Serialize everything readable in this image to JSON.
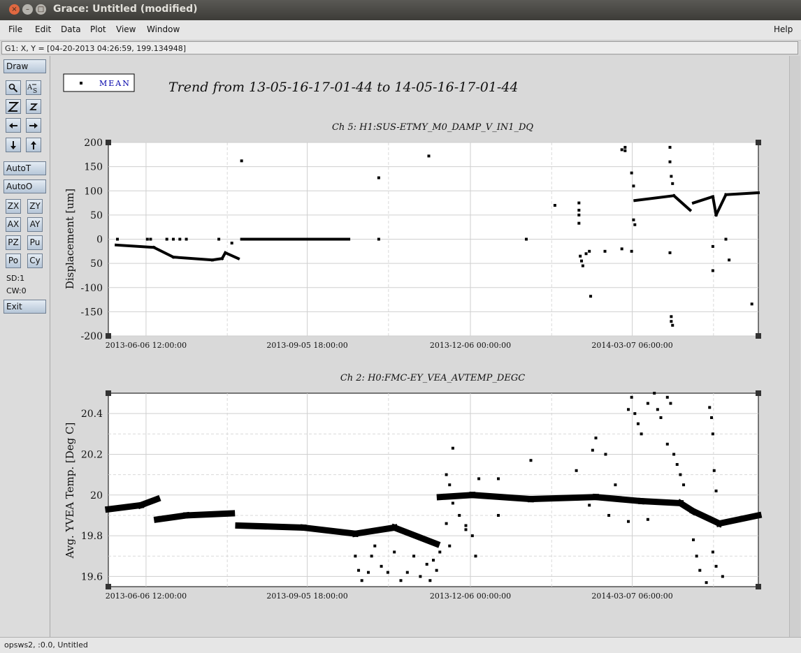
{
  "window": {
    "title": "Grace: Untitled (modified)"
  },
  "menu": {
    "file": "File",
    "edit": "Edit",
    "data": "Data",
    "plot": "Plot",
    "view": "View",
    "window": "Window",
    "help": "Help"
  },
  "locator": "G1: X, Y = [04-20-2013 04:26:59, 199.134948]",
  "toolbar": {
    "draw": "Draw",
    "autot": "AutoT",
    "autoo": "AutoO",
    "zx": "ZX",
    "zy": "ZY",
    "ax": "AX",
    "ay": "AY",
    "pz": "PZ",
    "pu": "Pu",
    "po": "Po",
    "cy": "Cy",
    "sd": "SD:1",
    "cw": "CW:0",
    "exit": "Exit",
    "icons": [
      "zoom-icon",
      "text-icon",
      "zoom-in-icon",
      "zoom-out-icon",
      "arrow-left-icon",
      "arrow-right-icon",
      "arrow-down-icon",
      "arrow-up-icon"
    ]
  },
  "statusbar": "opsws2, :0.0, Untitled",
  "legend": {
    "label": "MEAN"
  },
  "main_title": "Trend from 13-05-16-17-01-44 to 14-05-16-17-01-44",
  "chart_data": [
    {
      "type": "scatter",
      "title": "Ch 5: H1:SUS-ETMY_M0_DAMP_V_IN1_DQ",
      "ylabel": "Displacement [um]",
      "xlabel": "",
      "x_tick_labels": [
        "2013-06-06 12:00:00",
        "2013-09-05 18:00:00",
        "2013-12-06 00:00:00",
        "2014-03-07 06:00:00"
      ],
      "y_tick_labels": [
        "200",
        "150",
        "100",
        "50",
        "0",
        "50",
        "-100",
        "-150",
        "-200"
      ],
      "ylim": [
        -200,
        200
      ],
      "xlim": [
        0,
        1
      ],
      "grid": true,
      "series": [
        {
          "segments": [
            {
              "x0": 0.012,
              "y0": -12,
              "x1": 0.07,
              "y1": -17
            },
            {
              "x0": 0.07,
              "y0": -17,
              "x1": 0.1,
              "y1": -37
            },
            {
              "x0": 0.1,
              "y0": -37,
              "x1": 0.16,
              "y1": -43
            },
            {
              "x0": 0.16,
              "y0": -43,
              "x1": 0.175,
              "y1": -40
            },
            {
              "x0": 0.175,
              "y0": -40,
              "x1": 0.18,
              "y1": -28
            },
            {
              "x0": 0.18,
              "y0": -28,
              "x1": 0.2,
              "y1": -40
            },
            {
              "x0": 0.205,
              "y0": 0,
              "x1": 0.37,
              "y1": 0
            },
            {
              "x0": 0.81,
              "y0": 80,
              "x1": 0.87,
              "y1": 90
            },
            {
              "x0": 0.87,
              "y0": 90,
              "x1": 0.895,
              "y1": 60
            },
            {
              "x0": 0.9,
              "y0": 75,
              "x1": 0.93,
              "y1": 88
            },
            {
              "x0": 0.93,
              "y0": 88,
              "x1": 0.935,
              "y1": 50
            },
            {
              "x0": 0.935,
              "y0": 50,
              "x1": 0.95,
              "y1": 92
            },
            {
              "x0": 0.95,
              "y0": 92,
              "x1": 1.0,
              "y1": 96
            }
          ],
          "points": [
            [
              0.014,
              0
            ],
            [
              0.06,
              0
            ],
            [
              0.065,
              0
            ],
            [
              0.09,
              0
            ],
            [
              0.1,
              0
            ],
            [
              0.11,
              0
            ],
            [
              0.12,
              0
            ],
            [
              0.17,
              0
            ],
            [
              0.19,
              -8
            ],
            [
              0.205,
              162
            ],
            [
              0.416,
              127
            ],
            [
              0.416,
              0
            ],
            [
              0.493,
              172
            ],
            [
              0.643,
              0
            ],
            [
              0.687,
              70
            ],
            [
              0.724,
              75
            ],
            [
              0.724,
              60
            ],
            [
              0.724,
              50
            ],
            [
              0.724,
              33
            ],
            [
              0.726,
              -35
            ],
            [
              0.728,
              -45
            ],
            [
              0.73,
              -55
            ],
            [
              0.735,
              -30
            ],
            [
              0.74,
              -25
            ],
            [
              0.742,
              -118
            ],
            [
              0.764,
              -25
            ],
            [
              0.79,
              -20
            ],
            [
              0.79,
              185
            ],
            [
              0.795,
              190
            ],
            [
              0.795,
              183
            ],
            [
              0.805,
              137
            ],
            [
              0.805,
              -25
            ],
            [
              0.808,
              110
            ],
            [
              0.808,
              40
            ],
            [
              0.81,
              30
            ],
            [
              0.864,
              190
            ],
            [
              0.864,
              160
            ],
            [
              0.866,
              130
            ],
            [
              0.868,
              115
            ],
            [
              0.864,
              -28
            ],
            [
              0.866,
              -160
            ],
            [
              0.866,
              -170
            ],
            [
              0.868,
              -178
            ],
            [
              0.93,
              -15
            ],
            [
              0.93,
              -65
            ],
            [
              0.95,
              0
            ],
            [
              0.955,
              -43
            ],
            [
              0.99,
              -134
            ]
          ]
        }
      ]
    },
    {
      "type": "scatter",
      "title": "Ch 2: H0:FMC-EY_VEA_AVTEMP_DEGC",
      "ylabel": "Avg. YVEA Temp. [Deg C]",
      "xlabel": "",
      "x_tick_labels": [
        "2013-06-06 12:00:00",
        "2013-09-05 18:00:00",
        "2013-12-06 00:00:00",
        "2014-03-07 06:00:00"
      ],
      "y_tick_labels": [
        "20.4",
        "20.2",
        "20",
        "19.8",
        "19.6"
      ],
      "ylim": [
        19.55,
        20.5
      ],
      "xlim": [
        0,
        1
      ],
      "grid": true,
      "series": [
        {
          "segments": [
            {
              "x0": 0.0,
              "y0": 19.93,
              "x1": 0.05,
              "y1": 19.95
            },
            {
              "x0": 0.05,
              "y0": 19.95,
              "x1": 0.075,
              "y1": 19.98
            },
            {
              "x0": 0.075,
              "y0": 19.88,
              "x1": 0.12,
              "y1": 19.9
            },
            {
              "x0": 0.12,
              "y0": 19.9,
              "x1": 0.19,
              "y1": 19.91
            },
            {
              "x0": 0.2,
              "y0": 19.85,
              "x1": 0.3,
              "y1": 19.84
            },
            {
              "x0": 0.3,
              "y0": 19.84,
              "x1": 0.38,
              "y1": 19.81
            },
            {
              "x0": 0.38,
              "y0": 19.81,
              "x1": 0.44,
              "y1": 19.84
            },
            {
              "x0": 0.44,
              "y0": 19.84,
              "x1": 0.505,
              "y1": 19.76
            },
            {
              "x0": 0.51,
              "y0": 19.99,
              "x1": 0.56,
              "y1": 20.0
            },
            {
              "x0": 0.56,
              "y0": 20.0,
              "x1": 0.65,
              "y1": 19.98
            },
            {
              "x0": 0.65,
              "y0": 19.98,
              "x1": 0.75,
              "y1": 19.99
            },
            {
              "x0": 0.75,
              "y0": 19.99,
              "x1": 0.82,
              "y1": 19.97
            },
            {
              "x0": 0.82,
              "y0": 19.97,
              "x1": 0.88,
              "y1": 19.96
            },
            {
              "x0": 0.88,
              "y0": 19.96,
              "x1": 0.9,
              "y1": 19.92
            },
            {
              "x0": 0.9,
              "y0": 19.92,
              "x1": 0.94,
              "y1": 19.86
            },
            {
              "x0": 0.94,
              "y0": 19.86,
              "x1": 1.0,
              "y1": 19.9
            }
          ],
          "points": [
            [
              0.38,
              19.7
            ],
            [
              0.385,
              19.63
            ],
            [
              0.39,
              19.58
            ],
            [
              0.4,
              19.62
            ],
            [
              0.405,
              19.7
            ],
            [
              0.41,
              19.75
            ],
            [
              0.42,
              19.65
            ],
            [
              0.43,
              19.62
            ],
            [
              0.44,
              19.72
            ],
            [
              0.45,
              19.58
            ],
            [
              0.46,
              19.62
            ],
            [
              0.47,
              19.7
            ],
            [
              0.48,
              19.6
            ],
            [
              0.49,
              19.66
            ],
            [
              0.495,
              19.58
            ],
            [
              0.5,
              19.68
            ],
            [
              0.505,
              19.63
            ],
            [
              0.51,
              19.72
            ],
            [
              0.52,
              19.86
            ],
            [
              0.525,
              19.75
            ],
            [
              0.53,
              19.96
            ],
            [
              0.54,
              19.9
            ],
            [
              0.55,
              19.83
            ],
            [
              0.56,
              19.8
            ],
            [
              0.565,
              19.7
            ],
            [
              0.52,
              20.1
            ],
            [
              0.525,
              20.05
            ],
            [
              0.53,
              20.23
            ],
            [
              0.57,
              20.08
            ],
            [
              0.6,
              20.08
            ],
            [
              0.65,
              20.17
            ],
            [
              0.72,
              20.12
            ],
            [
              0.745,
              20.22
            ],
            [
              0.75,
              20.28
            ],
            [
              0.765,
              20.2
            ],
            [
              0.78,
              20.05
            ],
            [
              0.8,
              20.42
            ],
            [
              0.805,
              20.48
            ],
            [
              0.81,
              20.4
            ],
            [
              0.815,
              20.35
            ],
            [
              0.82,
              20.3
            ],
            [
              0.83,
              20.45
            ],
            [
              0.84,
              20.5
            ],
            [
              0.845,
              20.42
            ],
            [
              0.85,
              20.38
            ],
            [
              0.86,
              20.48
            ],
            [
              0.865,
              20.45
            ],
            [
              0.86,
              20.25
            ],
            [
              0.87,
              20.2
            ],
            [
              0.875,
              20.15
            ],
            [
              0.88,
              20.1
            ],
            [
              0.885,
              20.05
            ],
            [
              0.9,
              19.78
            ],
            [
              0.905,
              19.7
            ],
            [
              0.91,
              19.63
            ],
            [
              0.92,
              19.57
            ],
            [
              0.93,
              19.72
            ],
            [
              0.935,
              19.65
            ],
            [
              0.945,
              19.6
            ],
            [
              0.925,
              20.43
            ],
            [
              0.928,
              20.38
            ],
            [
              0.93,
              20.3
            ],
            [
              0.932,
              20.12
            ],
            [
              0.935,
              20.02
            ],
            [
              0.8,
              19.87
            ],
            [
              0.77,
              19.9
            ],
            [
              0.74,
              19.95
            ],
            [
              0.83,
              19.88
            ],
            [
              0.6,
              19.9
            ],
            [
              0.55,
              19.85
            ]
          ]
        }
      ]
    }
  ]
}
